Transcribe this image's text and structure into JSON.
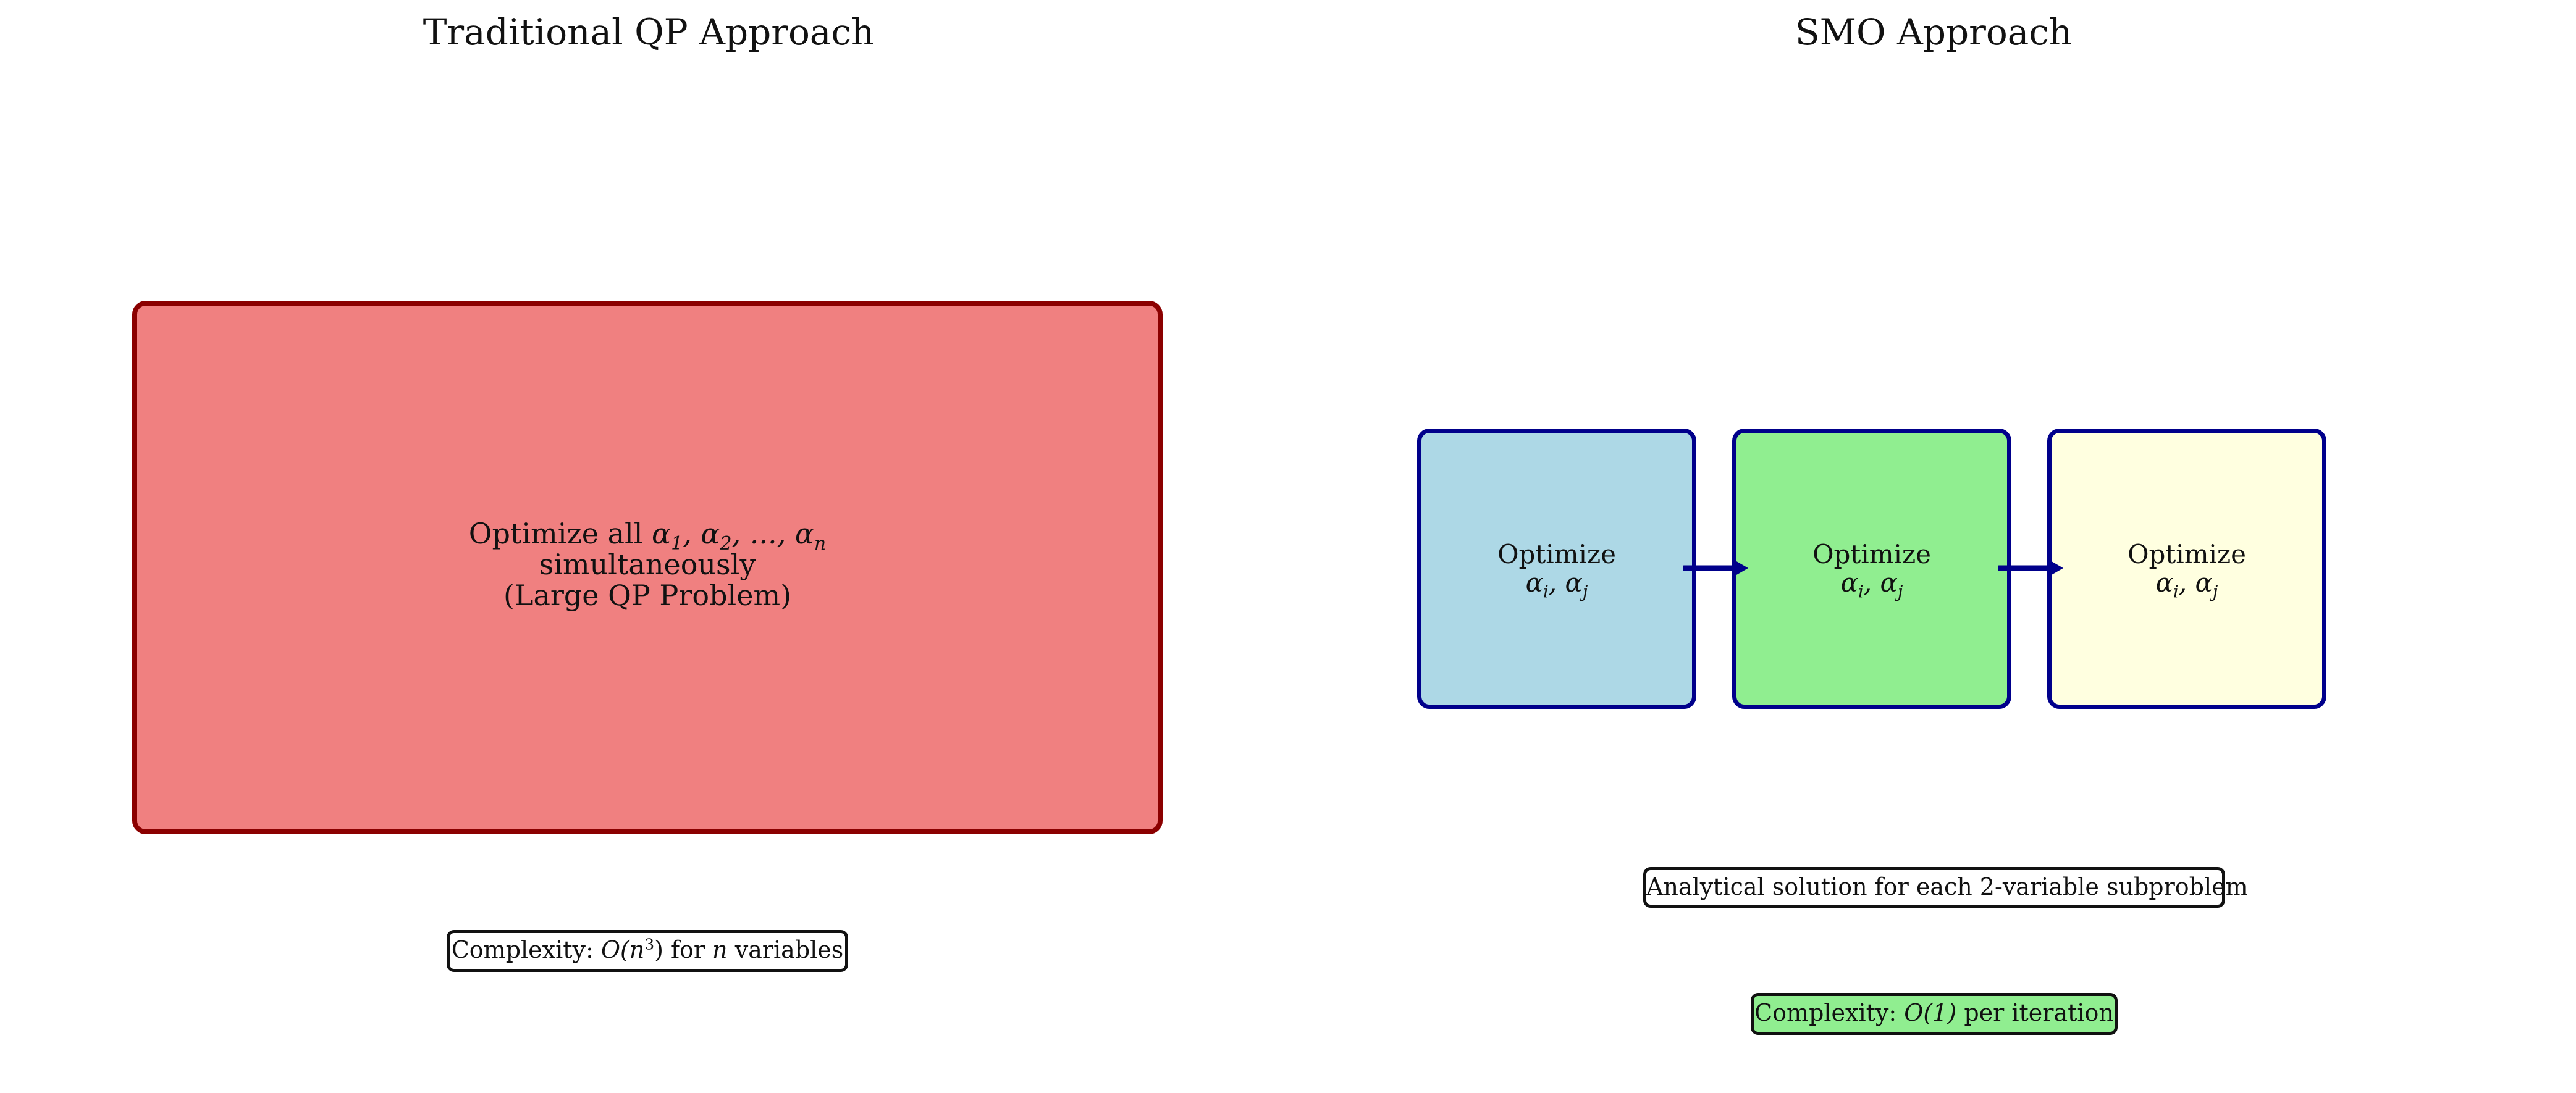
{
  "left_panel": {
    "title": "Traditional QP Approach",
    "box": {
      "line1_text": "Optimize all ",
      "line1_math": [
        "α",
        "1",
        ", α",
        "2",
        ", ..., α",
        "n"
      ],
      "line2": "simultaneously",
      "line3": "(Large QP Problem)",
      "fill_color": "#f08080",
      "border_color": "#8b0000"
    },
    "complexity": {
      "prefix": "Complexity: ",
      "math_main": "O",
      "math_open": "(n",
      "math_sup": "3",
      "math_close": ")",
      "middle": " for ",
      "var": "n",
      "suffix": " variables"
    }
  },
  "right_panel": {
    "title": "SMO Approach",
    "steps": [
      {
        "label": "Optimize",
        "var_a": "α",
        "sub_a": "i",
        "sep": ", ",
        "var_b": "α",
        "sub_b": "j",
        "fill_color": "#add8e6"
      },
      {
        "label": "Optimize",
        "var_a": "α",
        "sub_a": "i",
        "sep": ", ",
        "var_b": "α",
        "sub_b": "j",
        "fill_color": "#90ee90"
      },
      {
        "label": "Optimize",
        "var_a": "α",
        "sub_a": "i",
        "sep": ", ",
        "var_b": "α",
        "sub_b": "j",
        "fill_color": "#ffffe0"
      }
    ],
    "step_border_color": "#00008b",
    "arrow_color": "#00008b",
    "analytical_note": "Analytical solution for each 2-variable subproblem",
    "complexity": {
      "prefix": "Complexity: ",
      "math": "O(1)",
      "suffix": " per iteration",
      "fill_color": "#90ee90"
    }
  }
}
